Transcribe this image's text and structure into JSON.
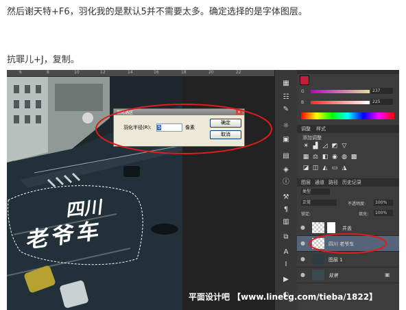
{
  "article": {
    "line1": "然后谢天特+F6，羽化我的是默认5并不需要太多。确定选择的是字体图层。",
    "line2": "抗罪儿+J，复制。"
  },
  "ruler": {
    "ticks": [
      "6",
      "8",
      "10",
      "12",
      "14",
      "16",
      "18",
      "20",
      "22"
    ]
  },
  "dialog": {
    "title": "羽化选区",
    "close_glyph": "×",
    "radius_label": "羽化半径(R):",
    "radius_value": "5",
    "unit": "像素",
    "ok_label": "确定",
    "cancel_label": "取消"
  },
  "canvas": {
    "text_line1": "四川",
    "text_line2": "老爷车"
  },
  "color_panel": {
    "values": [
      "237",
      "225"
    ],
    "channels": [
      "G",
      "B"
    ]
  },
  "adjustments_panel": {
    "tabs": [
      "调整",
      "样式"
    ],
    "add_label": "添加调整"
  },
  "layers_panel": {
    "tabs": [
      "图层",
      "通道",
      "路径",
      "历史记录"
    ],
    "kind_label": "类型",
    "blend_mode": "正常",
    "opacity_label": "不透明度:",
    "opacity_value": "100%",
    "lock_label": "锁定:",
    "fill_label": "填充:",
    "fill_value": "100%",
    "layers": [
      {
        "name": "井盖"
      },
      {
        "name": "四川 老爷车"
      },
      {
        "name": "图层 1"
      },
      {
        "name": "背景"
      }
    ]
  },
  "watermark": "平面设计吧 【www.linecg.com/tieba/1822】",
  "colors": {
    "annotation_red": "#e01b1b",
    "selection": "#3a5b8c"
  }
}
